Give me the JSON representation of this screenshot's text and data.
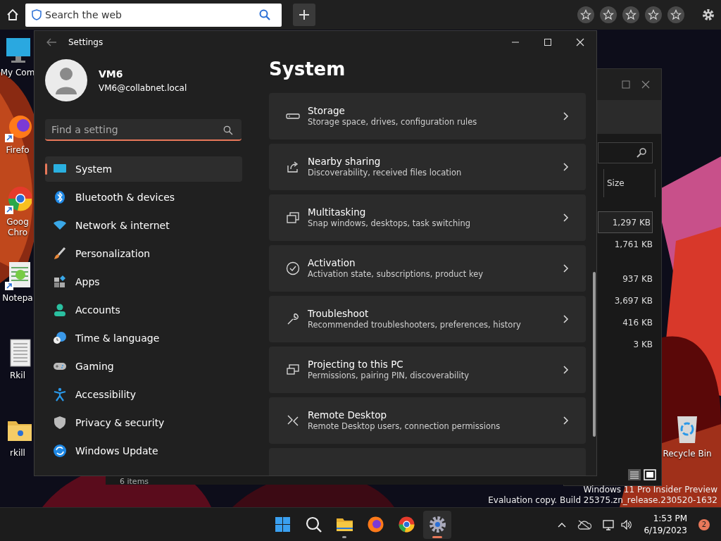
{
  "browser_bar": {
    "search_placeholder": "Search the web",
    "favorites": [
      {
        "selected": false
      },
      {
        "selected": false
      },
      {
        "selected": false
      },
      {
        "selected": false
      },
      {
        "selected": false
      }
    ]
  },
  "desktop_icons": [
    {
      "label": "My Com"
    },
    {
      "label": "Firefo"
    },
    {
      "label": "Goog Chro"
    },
    {
      "label": "Notepa"
    },
    {
      "label": "Rkil"
    },
    {
      "label": "rkill"
    },
    {
      "label": "Recycle Bin"
    }
  ],
  "explorer_window": {
    "column": "Size",
    "rows": [
      {
        "size": "1,297 KB",
        "selected": true
      },
      {
        "size": "1,761 KB",
        "selected": false
      },
      {
        "size": "937 KB",
        "selected": false
      },
      {
        "size": "3,697 KB",
        "selected": false
      },
      {
        "size": "416 KB",
        "selected": false
      },
      {
        "size": "3 KB",
        "selected": false
      }
    ],
    "status": "6 items"
  },
  "settings_window": {
    "title": "Settings",
    "user": {
      "name": "VM6",
      "email": "VM6@collabnet.local"
    },
    "search": {
      "placeholder": "Find a setting"
    },
    "nav": [
      {
        "label": "System",
        "selected": true
      },
      {
        "label": "Bluetooth & devices",
        "selected": false
      },
      {
        "label": "Network & internet",
        "selected": false
      },
      {
        "label": "Personalization",
        "selected": false
      },
      {
        "label": "Apps",
        "selected": false
      },
      {
        "label": "Accounts",
        "selected": false
      },
      {
        "label": "Time & language",
        "selected": false
      },
      {
        "label": "Gaming",
        "selected": false
      },
      {
        "label": "Accessibility",
        "selected": false
      },
      {
        "label": "Privacy & security",
        "selected": false
      },
      {
        "label": "Windows Update",
        "selected": false
      }
    ],
    "heading": "System",
    "cards": [
      {
        "title": "Storage",
        "description": "Storage space, drives, configuration rules"
      },
      {
        "title": "Nearby sharing",
        "description": "Discoverability, received files location"
      },
      {
        "title": "Multitasking",
        "description": "Snap windows, desktops, task switching"
      },
      {
        "title": "Activation",
        "description": "Activation state, subscriptions, product key"
      },
      {
        "title": "Troubleshoot",
        "description": "Recommended troubleshooters, preferences, history"
      },
      {
        "title": "Projecting to this PC",
        "description": "Permissions, pairing PIN, discoverability"
      },
      {
        "title": "Remote Desktop",
        "description": "Remote Desktop users, connection permissions"
      }
    ]
  },
  "watermark": [
    "Windows 11 Pro Insider Preview",
    "Evaluation copy. Build 25375.zn_release.230520-1632"
  ],
  "taskbar": {
    "apps": [
      {
        "running": false,
        "selected": false
      },
      {
        "running": false,
        "selected": false
      },
      {
        "running": true,
        "selected": false
      },
      {
        "running": false,
        "selected": false
      },
      {
        "running": false,
        "selected": false
      },
      {
        "running": true,
        "selected": true
      }
    ],
    "time": "1:53 PM",
    "date": "6/19/2023",
    "notifications": "2"
  }
}
